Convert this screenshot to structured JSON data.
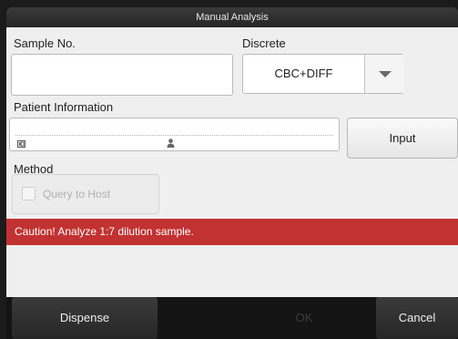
{
  "window": {
    "title": "Manual Analysis"
  },
  "sample": {
    "label": "Sample No.",
    "value": ""
  },
  "discrete": {
    "label": "Discrete",
    "value": "CBC+DIFF"
  },
  "patient": {
    "label": "Patient Information",
    "input_button": "Input"
  },
  "method": {
    "label": "Method",
    "query_label": "Query to Host",
    "query_checked": false
  },
  "caution": {
    "text": "Caution! Analyze 1:7 dilution sample.",
    "color": "#c23232"
  },
  "footer": {
    "dispense": "Dispense",
    "ok": "OK",
    "cancel": "Cancel"
  },
  "icons": {
    "id": "id-card-icon",
    "person": "person-icon",
    "dropdown": "chevron-down-icon"
  }
}
